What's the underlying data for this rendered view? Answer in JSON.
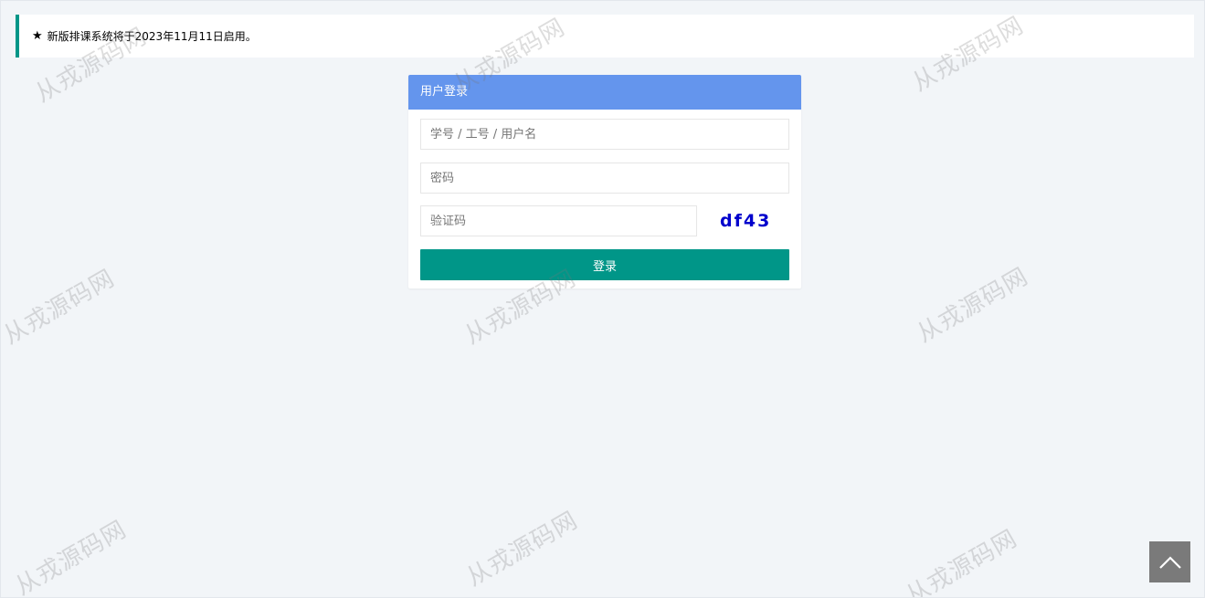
{
  "notice": {
    "icon": "star-icon",
    "text": "新版排课系统将于2023年11月11日启用。"
  },
  "login": {
    "title": "用户登录",
    "username_placeholder": "学号 / 工号 / 用户名",
    "password_placeholder": "密码",
    "captcha_placeholder": "验证码",
    "captcha_text": "df43",
    "submit_label": "登录"
  },
  "watermark": "从戎源码网",
  "back_to_top": {
    "icon": "chevron-up-icon"
  },
  "colors": {
    "accent": "#009688",
    "header": "#6495ed",
    "captcha": "#0000cc",
    "background": "#f2f5f8"
  }
}
